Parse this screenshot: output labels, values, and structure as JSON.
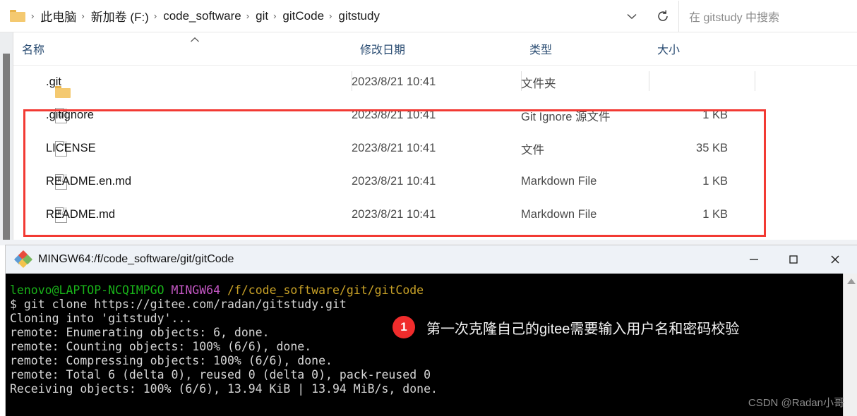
{
  "explorer": {
    "address": {
      "folder_icon": "folder-icon",
      "crumbs": [
        "此电脑",
        "新加卷 (F:)",
        "code_software",
        "git",
        "gitCode",
        "gitstudy"
      ],
      "separator": "›",
      "chevron_icon": "chevron-down-icon",
      "refresh_icon": "refresh-icon",
      "search_placeholder": "在 gitstudy 中搜索"
    },
    "columns": [
      {
        "label": "名称",
        "key": "name"
      },
      {
        "label": "修改日期",
        "key": "date"
      },
      {
        "label": "类型",
        "key": "type"
      },
      {
        "label": "大小",
        "key": "size"
      }
    ],
    "sort_caret": "▲",
    "rows": [
      {
        "name": ".git",
        "date": "2023/8/21 10:41",
        "type": "文件夹",
        "size": "",
        "icon": "folder-icon"
      },
      {
        "name": ".gitignore",
        "date": "2023/8/21 10:41",
        "type": "Git Ignore 源文件",
        "size": "1 KB",
        "icon": "gitignore-file-icon"
      },
      {
        "name": "LICENSE",
        "date": "2023/8/21 10:41",
        "type": "文件",
        "size": "35 KB",
        "icon": "generic-file-icon"
      },
      {
        "name": "README.en.md",
        "date": "2023/8/21 10:41",
        "type": "Markdown File",
        "size": "1 KB",
        "icon": "markdown-file-icon"
      },
      {
        "name": "README.md",
        "date": "2023/8/21 10:41",
        "type": "Markdown File",
        "size": "1 KB",
        "icon": "markdown-file-icon"
      }
    ],
    "highlight_color": "#f23a33"
  },
  "terminal": {
    "title": "MINGW64:/f/code_software/git/gitCode",
    "app_icon": "git-bash-icon",
    "window_buttons": {
      "minimize": "—",
      "maximize": "▢",
      "close": "✕"
    },
    "scroll_up_icon": "scroll-up-arrow-icon",
    "prompt": {
      "user_host": "lenovo@LAPTOP-NCQIMPGO",
      "shell": "MINGW64",
      "path": "/f/code_software/git/gitCode"
    },
    "lines": [
      "$ git clone https://gitee.com/radan/gitstudy.git",
      "Cloning into 'gitstudy'...",
      "remote: Enumerating objects: 6, done.",
      "remote: Counting objects: 100% (6/6), done.",
      "remote: Compressing objects: 100% (6/6), done.",
      "remote: Total 6 (delta 0), reused 0 (delta 0), pack-reused 0",
      "Receiving objects: 100% (6/6), 13.94 KiB | 13.94 MiB/s, done."
    ],
    "colors": {
      "user_host": "#19b319",
      "shell": "#c457c4",
      "path": "#c9a227",
      "text": "#d6d6d6",
      "background": "#000000"
    }
  },
  "annotation": {
    "badge": "1",
    "text": "第一次克隆自己的gitee需要输入用户名和密码校验",
    "badge_color": "#f02c2c"
  },
  "watermark": "CSDN @Radan小哥"
}
